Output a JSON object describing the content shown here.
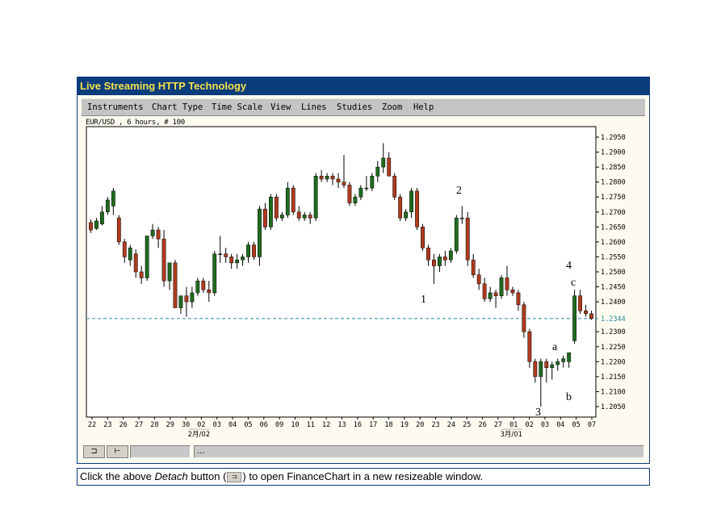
{
  "app": {
    "title": "Live Streaming HTTP Technology"
  },
  "menu": {
    "items": [
      "Instruments",
      "Chart Type",
      "Time Scale",
      "View",
      "Lines",
      "Studies",
      "Zoom",
      "Help"
    ]
  },
  "chart_label": "EUR/USD , 6 hours, # 100",
  "chart_data": {
    "type": "candlestick",
    "instrument": "EUR/USD",
    "interval": "6 hours",
    "bars_shown": 100,
    "ylim": [
      1.2015,
      1.2985
    ],
    "y_ticks": [
      "1.2950",
      "1.2900",
      "1.2850",
      "1.2800",
      "1.2750",
      "1.2700",
      "1.2650",
      "1.2600",
      "1.2550",
      "1.2500",
      "1.2450",
      "1.2400",
      "1.2300",
      "1.2250",
      "1.2200",
      "1.2150",
      "1.2100",
      "1.2050"
    ],
    "current_price": "1.2344",
    "x_ticks": [
      "22",
      "23",
      "26",
      "27",
      "28",
      "29",
      "30",
      "02",
      "03",
      "04",
      "05",
      "06",
      "09",
      "10",
      "11",
      "12",
      "13",
      "16",
      "17",
      "18",
      "19",
      "20",
      "23",
      "24",
      "25",
      "26",
      "27",
      "01",
      "02",
      "03",
      "04",
      "05",
      "07"
    ],
    "month_labels": [
      {
        "text": "2月/02",
        "after_tick": "02"
      },
      {
        "text": "3月/01",
        "after_tick": "01"
      }
    ],
    "annotations": [
      "1",
      "2",
      "3",
      "4",
      "a",
      "b",
      "c"
    ],
    "colors": {
      "up": "#1f6b1f",
      "down": "#b03a1e",
      "wick": "#000000",
      "current_line": "#2a8a9a",
      "border": "#000000"
    },
    "candles": [
      [
        1.2665,
        1.2675,
        1.263,
        1.264
      ],
      [
        1.2645,
        1.268,
        1.264,
        1.267
      ],
      [
        1.266,
        1.272,
        1.2655,
        1.27
      ],
      [
        1.27,
        1.275,
        1.269,
        1.274
      ],
      [
        1.272,
        1.278,
        1.269,
        1.277
      ],
      [
        1.268,
        1.269,
        1.259,
        1.26
      ],
      [
        1.26,
        1.261,
        1.253,
        1.255
      ],
      [
        1.254,
        1.259,
        1.252,
        1.258
      ],
      [
        1.256,
        1.2575,
        1.248,
        1.25
      ],
      [
        1.25,
        1.252,
        1.246,
        1.248
      ],
      [
        1.248,
        1.26,
        1.247,
        1.262
      ],
      [
        1.262,
        1.266,
        1.261,
        1.264
      ],
      [
        1.264,
        1.265,
        1.258,
        1.261
      ],
      [
        1.261,
        1.264,
        1.245,
        1.247
      ],
      [
        1.247,
        1.253,
        1.244,
        1.253
      ],
      [
        1.253,
        1.254,
        1.238,
        1.238
      ],
      [
        1.238,
        1.242,
        1.236,
        1.242
      ],
      [
        1.242,
        1.245,
        1.235,
        1.24
      ],
      [
        1.24,
        1.245,
        1.238,
        1.243
      ],
      [
        1.243,
        1.248,
        1.242,
        1.247
      ],
      [
        1.247,
        1.248,
        1.243,
        1.244
      ],
      [
        1.244,
        1.247,
        1.24,
        1.243
      ],
      [
        1.243,
        1.257,
        1.242,
        1.256
      ],
      [
        1.256,
        1.262,
        1.253,
        1.256
      ],
      [
        1.256,
        1.258,
        1.253,
        1.255
      ],
      [
        1.255,
        1.256,
        1.251,
        1.253
      ],
      [
        1.253,
        1.256,
        1.251,
        1.254
      ],
      [
        1.254,
        1.256,
        1.252,
        1.255
      ],
      [
        1.255,
        1.26,
        1.253,
        1.259
      ],
      [
        1.259,
        1.26,
        1.254,
        1.255
      ],
      [
        1.255,
        1.272,
        1.252,
        1.271
      ],
      [
        1.271,
        1.273,
        1.264,
        1.265
      ],
      [
        1.265,
        1.276,
        1.264,
        1.275
      ],
      [
        1.275,
        1.276,
        1.267,
        1.268
      ],
      [
        1.268,
        1.27,
        1.267,
        1.269
      ],
      [
        1.269,
        1.28,
        1.268,
        1.278
      ],
      [
        1.278,
        1.279,
        1.269,
        1.27
      ],
      [
        1.27,
        1.272,
        1.267,
        1.268
      ],
      [
        1.268,
        1.27,
        1.267,
        1.269
      ],
      [
        1.269,
        1.27,
        1.266,
        1.268
      ],
      [
        1.268,
        1.283,
        1.267,
        1.282
      ],
      [
        1.282,
        1.284,
        1.28,
        1.281
      ],
      [
        1.281,
        1.283,
        1.28,
        1.282
      ],
      [
        1.282,
        1.283,
        1.279,
        1.281
      ],
      [
        1.281,
        1.283,
        1.278,
        1.28
      ],
      [
        1.28,
        1.289,
        1.278,
        1.279
      ],
      [
        1.279,
        1.28,
        1.272,
        1.273
      ],
      [
        1.273,
        1.276,
        1.272,
        1.275
      ],
      [
        1.275,
        1.279,
        1.274,
        1.278
      ],
      [
        1.278,
        1.282,
        1.277,
        1.278
      ],
      [
        1.278,
        1.283,
        1.277,
        1.282
      ],
      [
        1.282,
        1.287,
        1.28,
        1.285
      ],
      [
        1.285,
        1.293,
        1.283,
        1.288
      ],
      [
        1.288,
        1.29,
        1.282,
        1.282
      ],
      [
        1.282,
        1.283,
        1.274,
        1.275
      ],
      [
        1.275,
        1.276,
        1.267,
        1.268
      ],
      [
        1.268,
        1.271,
        1.267,
        1.27
      ],
      [
        1.27,
        1.278,
        1.268,
        1.277
      ],
      [
        1.277,
        1.278,
        1.264,
        1.265
      ],
      [
        1.265,
        1.266,
        1.257,
        1.258
      ],
      [
        1.258,
        1.259,
        1.252,
        1.254
      ],
      [
        1.254,
        1.256,
        1.246,
        1.252
      ],
      [
        1.252,
        1.256,
        1.25,
        1.255
      ],
      [
        1.255,
        1.257,
        1.252,
        1.254
      ],
      [
        1.254,
        1.258,
        1.253,
        1.257
      ],
      [
        1.257,
        1.269,
        1.256,
        1.268
      ],
      [
        1.268,
        1.272,
        1.266,
        1.268
      ],
      [
        1.268,
        1.27,
        1.252,
        1.254
      ],
      [
        1.254,
        1.256,
        1.248,
        1.249
      ],
      [
        1.249,
        1.251,
        1.244,
        1.246
      ],
      [
        1.246,
        1.248,
        1.24,
        1.241
      ],
      [
        1.241,
        1.245,
        1.24,
        1.243
      ],
      [
        1.243,
        1.244,
        1.238,
        1.242
      ],
      [
        1.242,
        1.249,
        1.241,
        1.248
      ],
      [
        1.248,
        1.252,
        1.242,
        1.244
      ],
      [
        1.244,
        1.245,
        1.242,
        1.243
      ],
      [
        1.243,
        1.244,
        1.237,
        1.239
      ],
      [
        1.239,
        1.24,
        1.228,
        1.23
      ],
      [
        1.23,
        1.231,
        1.218,
        1.22
      ],
      [
        1.22,
        1.221,
        1.213,
        1.215
      ],
      [
        1.215,
        1.221,
        1.205,
        1.22
      ],
      [
        1.22,
        1.221,
        1.213,
        1.218
      ],
      [
        1.218,
        1.22,
        1.214,
        1.219
      ],
      [
        1.219,
        1.221,
        1.217,
        1.22
      ],
      [
        1.22,
        1.222,
        1.218,
        1.221
      ],
      [
        1.22,
        1.223,
        1.218,
        1.223
      ],
      [
        1.227,
        1.244,
        1.226,
        1.242
      ],
      [
        1.242,
        1.244,
        1.236,
        1.237
      ],
      [
        1.237,
        1.239,
        1.235,
        1.236
      ],
      [
        1.236,
        1.237,
        1.234,
        1.2344
      ]
    ]
  },
  "status": {
    "field_text": "...",
    "detach_button_glyph": "⊐",
    "line_button_glyph": "⊢"
  },
  "footer": {
    "prefix": "Click the above ",
    "emphasis": "Detach",
    "middle": " button (",
    "suffix": ") to open FinanceChart in a new resizeable window."
  }
}
